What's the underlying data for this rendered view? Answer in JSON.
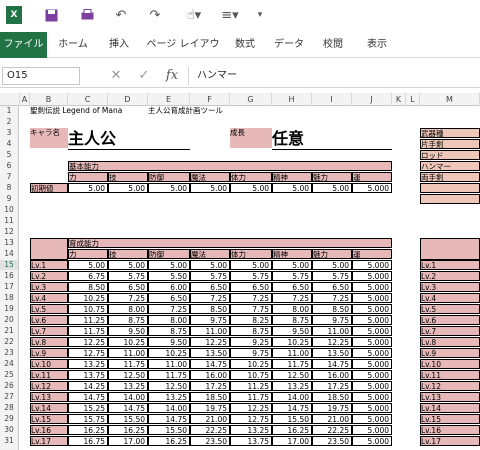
{
  "qat": {
    "app_icon": "excel-icon",
    "save": "save-icon",
    "print": "print-icon",
    "undo": "undo-icon",
    "redo": "redo-icon",
    "touch": "touch-mode-icon",
    "format": "format-icon",
    "more": "more-icon"
  },
  "ribbon": {
    "tabs": [
      "ファイル",
      "ホーム",
      "挿入",
      "ページ レイアウト",
      "数式",
      "データ",
      "校閲",
      "表示"
    ]
  },
  "formula": {
    "namebox": "O15",
    "cancel": "✕",
    "enter": "✓",
    "fx": "fx",
    "value": "ハンマー"
  },
  "columns": [
    "A",
    "B",
    "C",
    "D",
    "E",
    "F",
    "G",
    "H",
    "I",
    "J",
    "K",
    "L",
    "M"
  ],
  "rows": [
    "1",
    "2",
    "3",
    "4",
    "5",
    "6",
    "7",
    "8",
    "9",
    "10",
    "11",
    "12",
    "13",
    "14",
    "15",
    "16",
    "17",
    "18",
    "19",
    "20",
    "21",
    "22",
    "23",
    "24",
    "25",
    "26",
    "27",
    "28",
    "29",
    "30",
    "31"
  ],
  "sheet": {
    "title1": "聖剣伝説 Legend of Mana",
    "title2": "主人公育成計画ツール",
    "chara_label": "キャラ名",
    "chara_name": "主人公",
    "growth_label": "成長",
    "growth_value": "任意",
    "basic_header": "基本能力",
    "growth_header": "育成能力",
    "stats": [
      "力",
      "技",
      "防御",
      "魔法",
      "体力",
      "精神",
      "魅力",
      "運"
    ],
    "initial_label": "初期値",
    "initial_values": [
      "5.00",
      "5.00",
      "5.00",
      "5.00",
      "5.00",
      "5.00",
      "5.00",
      "5.000"
    ],
    "weapon_header": "武器種",
    "weapons": [
      "片手剣",
      "ロッド",
      "ハンマー",
      "両手剣"
    ],
    "levels": [
      {
        "lv": "Lv.1",
        "v": [
          "5.00",
          "5.00",
          "5.00",
          "5.00",
          "5.00",
          "5.00",
          "5.00",
          "5.000"
        ]
      },
      {
        "lv": "Lv.2",
        "v": [
          "6.75",
          "5.75",
          "5.50",
          "5.75",
          "5.75",
          "5.75",
          "5.75",
          "5.000"
        ]
      },
      {
        "lv": "Lv.3",
        "v": [
          "8.50",
          "6.50",
          "6.00",
          "6.50",
          "6.50",
          "6.50",
          "6.50",
          "5.000"
        ]
      },
      {
        "lv": "Lv.4",
        "v": [
          "10.25",
          "7.25",
          "6.50",
          "7.25",
          "7.25",
          "7.25",
          "7.25",
          "5.000"
        ]
      },
      {
        "lv": "Lv.5",
        "v": [
          "10.75",
          "8.00",
          "7.25",
          "8.50",
          "7.75",
          "8.00",
          "8.50",
          "5.000"
        ]
      },
      {
        "lv": "Lv.6",
        "v": [
          "11.25",
          "8.75",
          "8.00",
          "9.75",
          "8.25",
          "8.75",
          "9.75",
          "5.000"
        ]
      },
      {
        "lv": "Lv.7",
        "v": [
          "11.75",
          "9.50",
          "8.75",
          "11.00",
          "8.75",
          "9.50",
          "11.00",
          "5.000"
        ]
      },
      {
        "lv": "Lv.8",
        "v": [
          "12.25",
          "10.25",
          "9.50",
          "12.25",
          "9.25",
          "10.25",
          "12.25",
          "5.000"
        ]
      },
      {
        "lv": "Lv.9",
        "v": [
          "12.75",
          "11.00",
          "10.25",
          "13.50",
          "9.75",
          "11.00",
          "13.50",
          "5.000"
        ]
      },
      {
        "lv": "Lv.10",
        "v": [
          "13.25",
          "11.75",
          "11.00",
          "14.75",
          "10.25",
          "11.75",
          "14.75",
          "5.000"
        ]
      },
      {
        "lv": "Lv.11",
        "v": [
          "13.75",
          "12.50",
          "11.75",
          "16.00",
          "10.75",
          "12.50",
          "16.00",
          "5.000"
        ]
      },
      {
        "lv": "Lv.12",
        "v": [
          "14.25",
          "13.25",
          "12.50",
          "17.25",
          "11.25",
          "13.25",
          "17.25",
          "5.000"
        ]
      },
      {
        "lv": "Lv.13",
        "v": [
          "14.75",
          "14.00",
          "13.25",
          "18.50",
          "11.75",
          "14.00",
          "18.50",
          "5.000"
        ]
      },
      {
        "lv": "Lv.14",
        "v": [
          "15.25",
          "14.75",
          "14.00",
          "19.75",
          "12.25",
          "14.75",
          "19.75",
          "5.000"
        ]
      },
      {
        "lv": "Lv.15",
        "v": [
          "15.75",
          "15.50",
          "14.75",
          "21.00",
          "12.75",
          "15.50",
          "21.00",
          "5.000"
        ]
      },
      {
        "lv": "Lv.16",
        "v": [
          "16.25",
          "16.25",
          "15.50",
          "22.25",
          "13.25",
          "16.25",
          "22.25",
          "5.000"
        ]
      },
      {
        "lv": "Lv.17",
        "v": [
          "16.75",
          "17.00",
          "16.25",
          "23.50",
          "13.75",
          "17.00",
          "23.50",
          "5.000"
        ]
      }
    ]
  }
}
